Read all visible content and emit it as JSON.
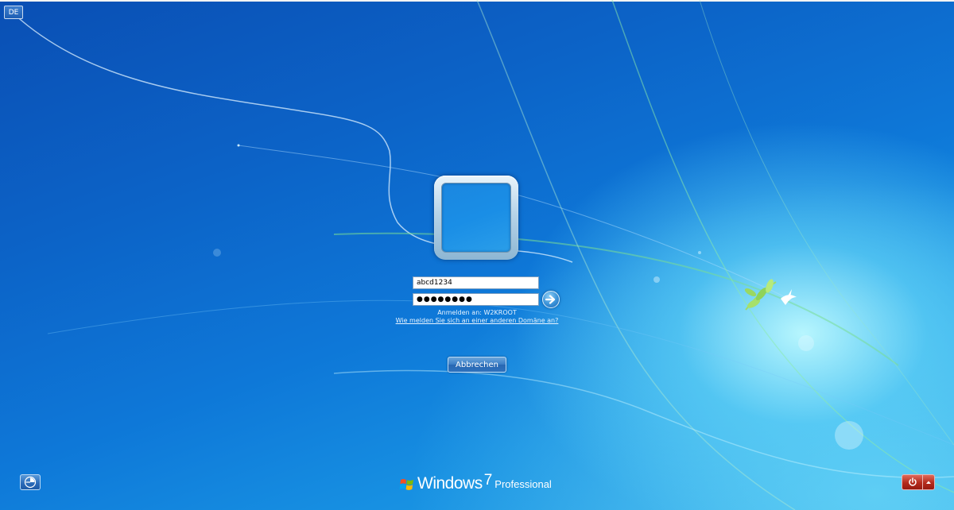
{
  "language_indicator": "DE",
  "login": {
    "username_value": "abcd1234",
    "password_value": "●●●●●●●●",
    "signin_domain_text": "Anmelden an: W2KROOT",
    "domain_help_link": "Wie melden Sie sich an einer anderen Domäne an?",
    "cancel_label": "Abbrechen"
  },
  "branding": {
    "product": "Windows",
    "version": "7",
    "edition": "Professional"
  },
  "icons": {
    "submit": "arrow-right-icon",
    "ease_of_access": "ease-of-access-icon",
    "shutdown": "power-icon",
    "shutdown_options": "caret-up-icon",
    "logo": "windows-flag-icon"
  },
  "colors": {
    "background_dark": "#0a4fb4",
    "background_light": "#aef0ff",
    "shutdown_red": "#b42a1c"
  }
}
